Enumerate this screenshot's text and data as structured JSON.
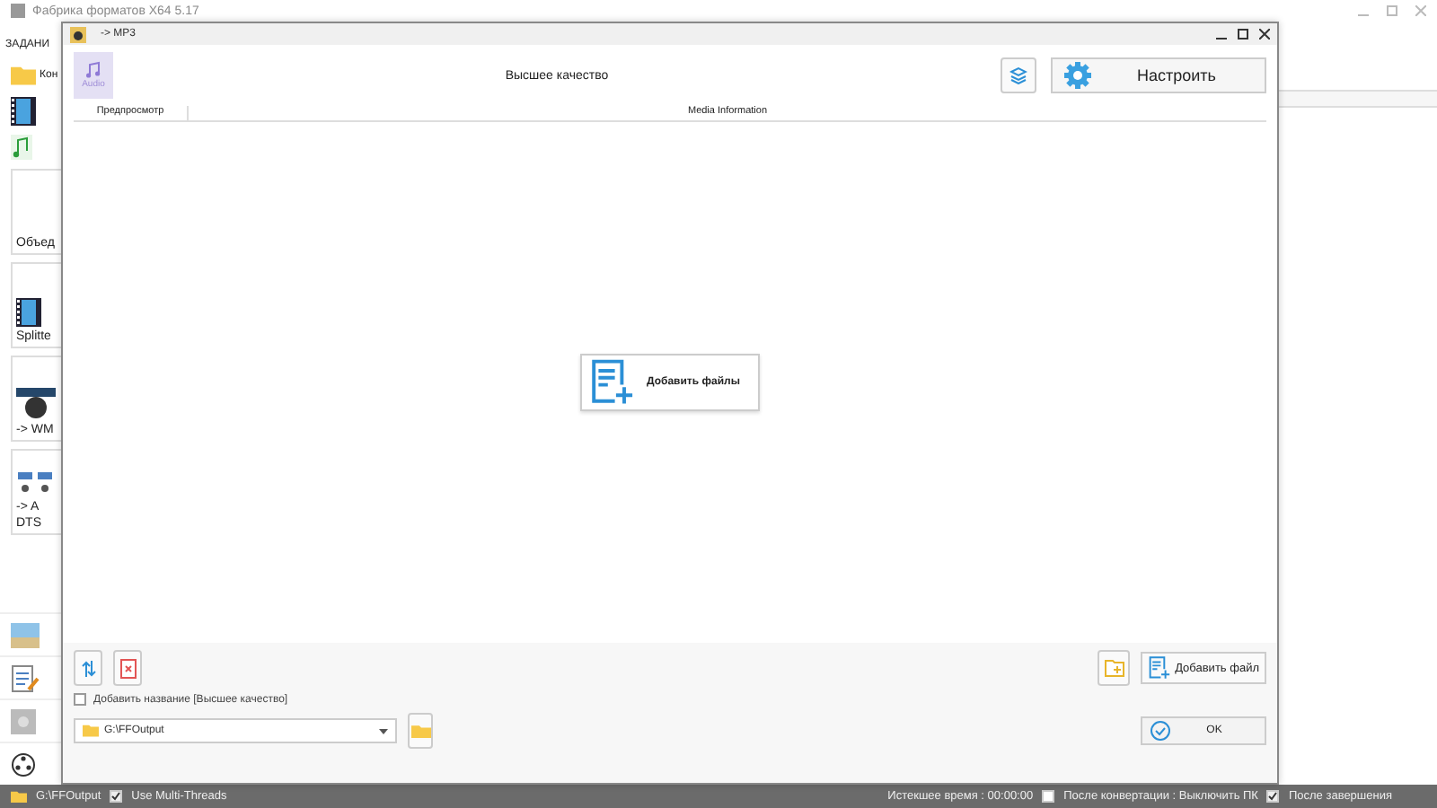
{
  "app": {
    "title": "Фабрика форматов X64 5.17",
    "tab": "ЗАДАНИ",
    "quick_items": [
      {
        "label": "Кон",
        "kind": "folder"
      },
      {
        "kind": "film"
      },
      {
        "kind": "music"
      }
    ],
    "task_cards": [
      {
        "lines": [
          "Объед"
        ],
        "kind": "blank"
      },
      {
        "lines": [
          "Splitte"
        ],
        "kind": "film"
      },
      {
        "lines": [
          "-> WM"
        ],
        "kind": "disc"
      },
      {
        "lines": [
          "-> A",
          "DTS"
        ],
        "kind": "audio"
      }
    ],
    "tools": [
      {
        "kind": "picture"
      },
      {
        "kind": "document"
      },
      {
        "kind": "drive"
      },
      {
        "kind": "reel"
      }
    ]
  },
  "dialog": {
    "title": "-> MP3",
    "format_badge": "Audio",
    "preset": "Высшее качество",
    "settings_button": "Настроить",
    "columns": [
      "Предпросмотр",
      "Media Information"
    ],
    "add_files_center": "Добавить файлы",
    "add_title": {
      "label": "Добавить название [Высшее качество]",
      "checked": false
    },
    "output_path": "G:\\FFOutput",
    "add_file_button": "Добавить файл",
    "ok_button": "OK"
  },
  "status_bar": {
    "output_folder": "G:\\FFOutput",
    "multi_threads": {
      "label": "Use Multi-Threads",
      "checked": true
    },
    "elapsed": "Истекшее время : 00:00:00",
    "shutdown": {
      "label": "После конвертации : Выключить ПК",
      "checked": false
    },
    "after_done": {
      "label": "После завершения",
      "checked": true
    }
  }
}
